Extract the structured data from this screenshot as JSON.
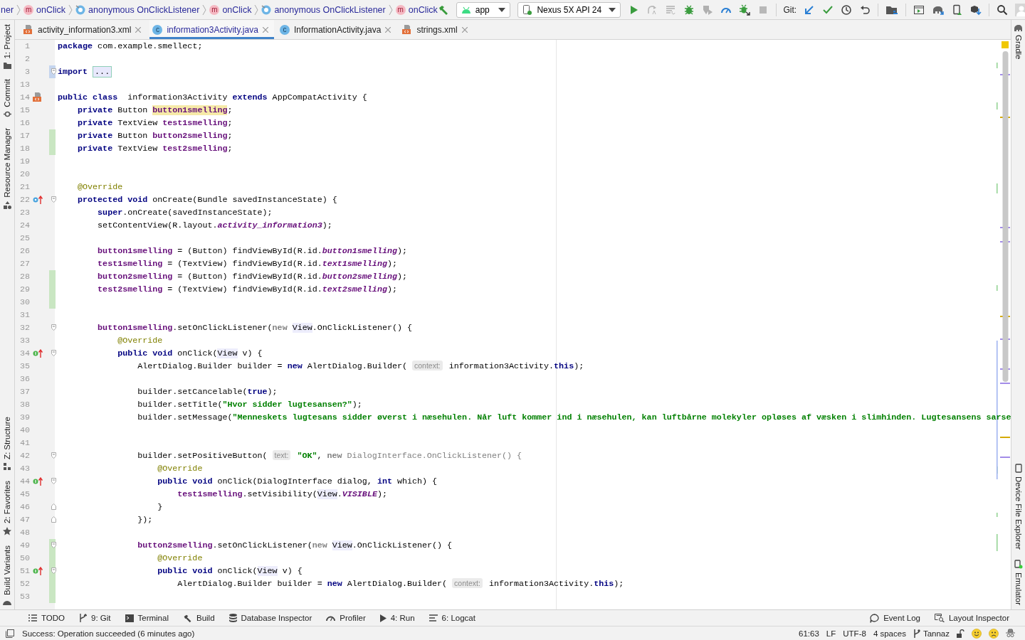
{
  "breadcrumb": [
    {
      "kind": "text",
      "label": "ner"
    },
    {
      "kind": "method",
      "badge": "m",
      "label": "onClick"
    },
    {
      "kind": "anonymous",
      "label": "anonymous OnClickListener"
    },
    {
      "kind": "method",
      "badge": "m",
      "label": "onClick"
    },
    {
      "kind": "anonymous",
      "label": "anonymous OnClickListener"
    },
    {
      "kind": "method",
      "badge": "m",
      "label": "onClick"
    }
  ],
  "toolbar": {
    "run_config": "app",
    "device": "Nexus 5X API 24",
    "git_label": "Git:"
  },
  "tabs": [
    {
      "kind": "xml",
      "label": "activity_information3.xml",
      "selected": false
    },
    {
      "kind": "class",
      "badge": "c",
      "label": "information3Activity.java",
      "selected": true
    },
    {
      "kind": "class",
      "badge": "c",
      "label": "InformationActivity.java",
      "selected": false
    },
    {
      "kind": "xml",
      "label": "strings.xml",
      "selected": false
    }
  ],
  "left_tool_windows": {
    "top": [
      "1: Project",
      "Commit",
      "Resource Manager"
    ],
    "bottom": [
      "Z: Structure",
      "2: Favorites",
      "Build Variants"
    ]
  },
  "right_tool_windows": {
    "top": [
      "Gradle"
    ],
    "bottom": [
      "Device File Explorer",
      "Emulator"
    ]
  },
  "editor": {
    "lines": [
      {
        "number": "1",
        "tokens": [
          {
            "kind": "kw",
            "text": "package"
          },
          {
            "kind": "plain",
            "text": " com.example.smellect;"
          }
        ]
      },
      {
        "number": "2"
      },
      {
        "number": "3",
        "change": {
          "kind": "modified"
        },
        "fold": {
          "kind": "start"
        },
        "tokens": [
          {
            "kind": "kw",
            "text": "import "
          },
          {
            "kind": "folded",
            "text": "..."
          }
        ]
      },
      {
        "number": "13"
      },
      {
        "number": "14",
        "gutter": {
          "kind": "layout"
        },
        "tokens": [
          {
            "kind": "kw",
            "text": "public class"
          },
          {
            "kind": "plain",
            "text": "  information3Activity "
          },
          {
            "kind": "kw",
            "text": "extends"
          },
          {
            "kind": "plain",
            "text": " AppCompatActivity {"
          }
        ]
      },
      {
        "number": "15",
        "tokens": [
          {
            "kind": "kw",
            "text": "    private"
          },
          {
            "kind": "plain",
            "text": " Button "
          },
          {
            "kind": "hl",
            "text": "button1smelling"
          },
          {
            "kind": "plain",
            "text": ";"
          }
        ]
      },
      {
        "number": "16",
        "tokens": [
          {
            "kind": "kw",
            "text": "    private"
          },
          {
            "kind": "plain",
            "text": " TextView "
          },
          {
            "kind": "field",
            "text": "test1smelling"
          },
          {
            "kind": "plain",
            "text": ";"
          }
        ]
      },
      {
        "number": "17",
        "change": {
          "kind": "added"
        },
        "tokens": [
          {
            "kind": "kw",
            "text": "    private"
          },
          {
            "kind": "plain",
            "text": " Button "
          },
          {
            "kind": "field",
            "text": "button2smelling"
          },
          {
            "kind": "plain",
            "text": ";"
          }
        ]
      },
      {
        "number": "18",
        "change": {
          "kind": "added"
        },
        "tokens": [
          {
            "kind": "kw",
            "text": "    private"
          },
          {
            "kind": "plain",
            "text": " TextView "
          },
          {
            "kind": "field",
            "text": "test2smelling"
          },
          {
            "kind": "plain",
            "text": ";"
          }
        ]
      },
      {
        "number": "19"
      },
      {
        "number": "20"
      },
      {
        "number": "21",
        "tokens": [
          {
            "kind": "ann",
            "text": "    @Override"
          }
        ]
      },
      {
        "number": "22",
        "gutter": {
          "kind": "override"
        },
        "fold": {
          "kind": "start"
        },
        "tokens": [
          {
            "kind": "kw",
            "text": "    protected void"
          },
          {
            "kind": "plain",
            "text": " onCreate(Bundle savedInstanceState) {"
          }
        ]
      },
      {
        "number": "23",
        "tokens": [
          {
            "kind": "kw",
            "text": "        super"
          },
          {
            "kind": "plain",
            "text": ".onCreate(savedInstanceState);"
          }
        ]
      },
      {
        "number": "24",
        "tokens": [
          {
            "kind": "plain",
            "text": "        setContentView(R.layout."
          },
          {
            "kind": "fi",
            "text": "activity_information3"
          },
          {
            "kind": "plain",
            "text": ");"
          }
        ]
      },
      {
        "number": "25"
      },
      {
        "number": "26",
        "tokens": [
          {
            "kind": "field",
            "text": "        button1smelling"
          },
          {
            "kind": "plain",
            "text": " = (Button) findViewById(R.id."
          },
          {
            "kind": "fi",
            "text": "button1smelling"
          },
          {
            "kind": "plain",
            "text": ");"
          }
        ]
      },
      {
        "number": "27",
        "tokens": [
          {
            "kind": "field",
            "text": "        test1smelling"
          },
          {
            "kind": "plain",
            "text": " = (TextView) findViewById(R.id."
          },
          {
            "kind": "fi",
            "text": "text1smelling"
          },
          {
            "kind": "plain",
            "text": ");"
          }
        ]
      },
      {
        "number": "28",
        "change": {
          "kind": "added"
        },
        "tokens": [
          {
            "kind": "field",
            "text": "        button2smelling"
          },
          {
            "kind": "plain",
            "text": " = (Button) findViewById(R.id."
          },
          {
            "kind": "fi",
            "text": "button2smelling"
          },
          {
            "kind": "plain",
            "text": ");"
          }
        ]
      },
      {
        "number": "29",
        "change": {
          "kind": "added"
        },
        "tokens": [
          {
            "kind": "field",
            "text": "        test2smelling"
          },
          {
            "kind": "plain",
            "text": " = (TextView) findViewById(R.id."
          },
          {
            "kind": "fi",
            "text": "text2smelling"
          },
          {
            "kind": "plain",
            "text": ");"
          }
        ]
      },
      {
        "number": "30",
        "change": {
          "kind": "added"
        }
      },
      {
        "number": "31"
      },
      {
        "number": "32",
        "fold": {
          "kind": "start"
        },
        "tokens": [
          {
            "kind": "field",
            "text": "        button1smelling"
          },
          {
            "kind": "plain",
            "text": ".setOnClickListener("
          },
          {
            "kind": "dim",
            "text": "new "
          },
          {
            "kind": "cls",
            "text": "View"
          },
          {
            "kind": "plain",
            "text": ".OnClickListener() {"
          }
        ]
      },
      {
        "number": "33",
        "tokens": [
          {
            "kind": "ann",
            "text": "            @Override"
          }
        ]
      },
      {
        "number": "34",
        "gutter": {
          "kind": "implements"
        },
        "fold": {
          "kind": "start"
        },
        "tokens": [
          {
            "kind": "kw",
            "text": "            public void"
          },
          {
            "kind": "plain",
            "text": " onClick("
          },
          {
            "kind": "cls",
            "text": "View"
          },
          {
            "kind": "plain",
            "text": " v) {"
          }
        ]
      },
      {
        "number": "35",
        "tokens": [
          {
            "kind": "plain",
            "text": "                AlertDialog.Builder builder = "
          },
          {
            "kind": "kw",
            "text": "new"
          },
          {
            "kind": "plain",
            "text": " AlertDialog.Builder( "
          },
          {
            "kind": "hint",
            "text": "context:"
          },
          {
            "kind": "plain",
            "text": " information3Activity."
          },
          {
            "kind": "kw",
            "text": "this"
          },
          {
            "kind": "plain",
            "text": ");"
          }
        ]
      },
      {
        "number": "36"
      },
      {
        "number": "37",
        "tokens": [
          {
            "kind": "plain",
            "text": "                builder.setCancelable("
          },
          {
            "kind": "kw",
            "text": "true"
          },
          {
            "kind": "plain",
            "text": ");"
          }
        ]
      },
      {
        "number": "38",
        "tokens": [
          {
            "kind": "plain",
            "text": "                builder.setTitle("
          },
          {
            "kind": "str",
            "text": "\"Hvor sidder lugtesansen?\""
          },
          {
            "kind": "plain",
            "text": ");"
          }
        ]
      },
      {
        "number": "39",
        "tokens": [
          {
            "kind": "plain",
            "text": "                builder.setMessage("
          },
          {
            "kind": "str",
            "text": "\"Menneskets lugtesans sidder øverst i næsehulen. Når luft kommer ind i næsehulen, kan luftbårne molekyler opløses af væsken i slimhinden. Lugtesansens sarse"
          }
        ]
      },
      {
        "number": "40"
      },
      {
        "number": "41"
      },
      {
        "number": "42",
        "fold": {
          "kind": "start"
        },
        "tokens": [
          {
            "kind": "plain",
            "text": "                builder.setPositiveButton( "
          },
          {
            "kind": "hint",
            "text": "text:"
          },
          {
            "kind": "str",
            "text": " \"OK\""
          },
          {
            "kind": "plain",
            "text": ", "
          },
          {
            "kind": "dim",
            "text": "new"
          },
          {
            "kind": "dimplain",
            "text": " DialogInterface.OnClickListener() {"
          }
        ]
      },
      {
        "number": "43",
        "tokens": [
          {
            "kind": "ann",
            "text": "                    @Override"
          }
        ]
      },
      {
        "number": "44",
        "gutter": {
          "kind": "implements"
        },
        "fold": {
          "kind": "start"
        },
        "tokens": [
          {
            "kind": "kw",
            "text": "                    public void"
          },
          {
            "kind": "plain",
            "text": " onClick(DialogInterface dialog, "
          },
          {
            "kind": "kw",
            "text": "int"
          },
          {
            "kind": "plain",
            "text": " which) {"
          }
        ]
      },
      {
        "number": "45",
        "tokens": [
          {
            "kind": "field",
            "text": "                        test1smelling"
          },
          {
            "kind": "plain",
            "text": ".setVisibility("
          },
          {
            "kind": "cls",
            "text": "View"
          },
          {
            "kind": "plain",
            "text": "."
          },
          {
            "kind": "fi",
            "text": "VISIBLE"
          },
          {
            "kind": "plain",
            "text": ");"
          }
        ]
      },
      {
        "number": "46",
        "fold": {
          "kind": "end"
        },
        "tokens": [
          {
            "kind": "plain",
            "text": "                    }"
          }
        ]
      },
      {
        "number": "47",
        "fold": {
          "kind": "end"
        },
        "tokens": [
          {
            "kind": "plain",
            "text": "                });"
          }
        ]
      },
      {
        "number": "48"
      },
      {
        "number": "49",
        "change": {
          "kind": "added"
        },
        "fold": {
          "kind": "start"
        },
        "tokens": [
          {
            "kind": "field",
            "text": "                button2smelling"
          },
          {
            "kind": "plain",
            "text": ".setOnClickListener("
          },
          {
            "kind": "dim",
            "text": "new "
          },
          {
            "kind": "cls",
            "text": "View"
          },
          {
            "kind": "plain",
            "text": ".OnClickListener() {"
          }
        ]
      },
      {
        "number": "50",
        "change": {
          "kind": "added"
        },
        "tokens": [
          {
            "kind": "ann",
            "text": "                    @Override"
          }
        ]
      },
      {
        "number": "51",
        "change": {
          "kind": "added"
        },
        "gutter": {
          "kind": "implements"
        },
        "fold": {
          "kind": "start"
        },
        "tokens": [
          {
            "kind": "kw",
            "text": "                    public void"
          },
          {
            "kind": "plain",
            "text": " onClick("
          },
          {
            "kind": "cls",
            "text": "View"
          },
          {
            "kind": "plain",
            "text": " v) {"
          }
        ]
      },
      {
        "number": "52",
        "change": {
          "kind": "added"
        },
        "tokens": [
          {
            "kind": "plain",
            "text": "                        AlertDialog.Builder builder = "
          },
          {
            "kind": "kw",
            "text": "new"
          },
          {
            "kind": "plain",
            "text": " AlertDialog.Builder( "
          },
          {
            "kind": "hint",
            "text": "context:"
          },
          {
            "kind": "plain",
            "text": " information3Activity."
          },
          {
            "kind": "kw",
            "text": "this"
          },
          {
            "kind": "plain",
            "text": ");"
          }
        ]
      },
      {
        "number": "53",
        "change": {
          "kind": "added"
        }
      }
    ]
  },
  "bottom_tool_windows": {
    "left": [
      "TODO",
      "9: Git",
      "Terminal",
      "Build",
      "Database Inspector",
      "Profiler",
      "4: Run",
      "6: Logcat"
    ],
    "right": [
      "Event Log",
      "Layout Inspector"
    ]
  },
  "status_bar": {
    "message": "Success: Operation succeeded (6 minutes ago)",
    "items": [
      "61:63",
      "LF",
      "UTF-8",
      "4 spaces"
    ],
    "branch": "Tannaz"
  }
}
